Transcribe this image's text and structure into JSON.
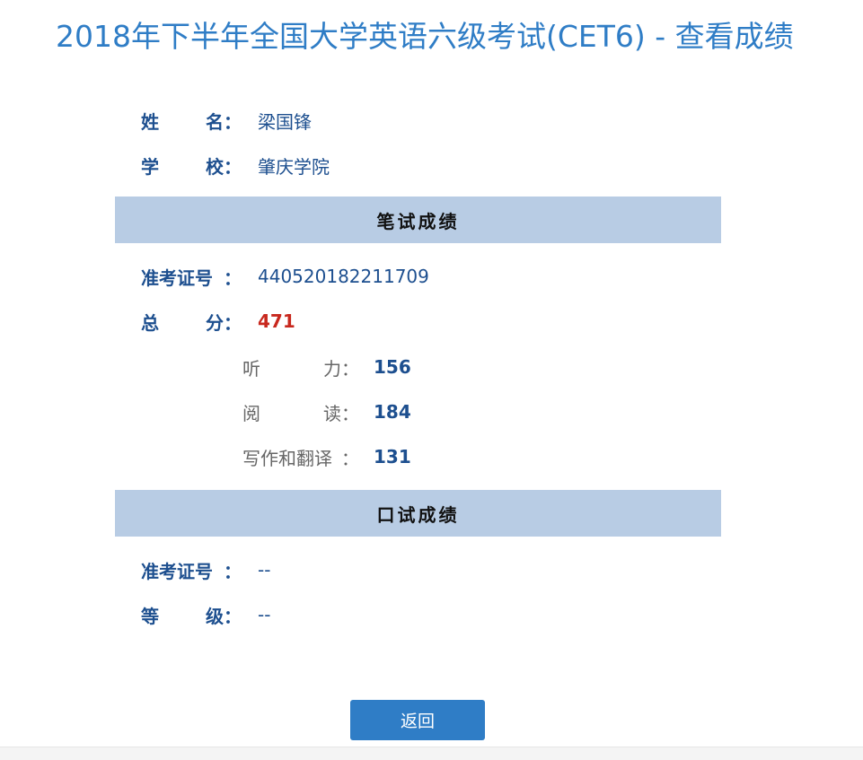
{
  "title": "2018年下半年全国大学英语六级考试(CET6) - 查看成绩",
  "colon": "：",
  "personal": {
    "name_label_a": "姓",
    "name_label_b": "名",
    "name_value": "梁国锋",
    "school_label_a": "学",
    "school_label_b": "校",
    "school_value": "肇庆学院"
  },
  "written": {
    "section_title": "笔试成绩",
    "ticket_label": "准考证号",
    "ticket_value": "440520182211709",
    "total_label_a": "总",
    "total_label_b": "分",
    "total_value": "471",
    "listening_label_a": "听",
    "listening_label_b": "力",
    "listening_value": "156",
    "reading_label_a": "阅",
    "reading_label_b": "读",
    "reading_value": "184",
    "writing_label": "写作和翻译",
    "writing_value": "131"
  },
  "oral": {
    "section_title": "口试成绩",
    "ticket_label": "准考证号",
    "ticket_value": "--",
    "grade_label_a": "等",
    "grade_label_b": "级",
    "grade_value": "--"
  },
  "back_button": "返回",
  "colors": {
    "title": "#2f7dc6",
    "label": "#1d4f8f",
    "total": "#c8281e",
    "section_bar": "#b8cce4",
    "button": "#2f7dc6"
  }
}
